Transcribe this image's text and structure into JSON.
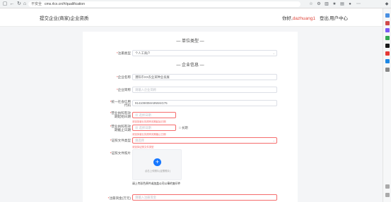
{
  "browser": {
    "secure_label": "不安全",
    "url": "cms.rlcx.cn/#/qualification"
  },
  "header": {
    "title": "提交企业(商家)企业资质",
    "greeting": "你好,",
    "username": "dazhuang1",
    "logout": "登出",
    "user_center": "用户中心"
  },
  "form": {
    "section_type": "— 单位类型 —",
    "section_info": "— 企业信息 —",
    "reg_type": {
      "label": "注册类型",
      "value": "个人工商户"
    },
    "company_name": {
      "label": "企业名称",
      "value": "濮阳市XX农业某种业发展"
    },
    "short_name": {
      "label": "企业简称",
      "placeholder": "请输入企业简称"
    },
    "credit_code": {
      "label_line1": "统一社会信用",
      "label_line2": "代码",
      "value": "91410900MA9NW4G75"
    },
    "license_start": {
      "label_line1": "营业执照有效",
      "label_line2": "期起始日期",
      "placeholder": "选择日期",
      "error": "请选择营业执照有效期起始日期"
    },
    "license_end": {
      "label_line1": "营业执照有效",
      "label_line2": "期截止日期",
      "placeholder": "选择日期",
      "longterm": "长期",
      "error": "请选择营业执照有效期截止日期"
    },
    "cert_type": {
      "label": "证照文件类型",
      "placeholder": "请选择",
      "error": "请选择证照文件类型"
    },
    "cert_photo": {
      "label": "证照文件照片",
      "upload_hint": "点击上传照片(证照照片)",
      "note": "请上传彩色原件或加盖公司公章的复印件"
    },
    "reg_capital": {
      "label": "注册资金(万元)",
      "placeholder": "请输入注册资金"
    }
  }
}
